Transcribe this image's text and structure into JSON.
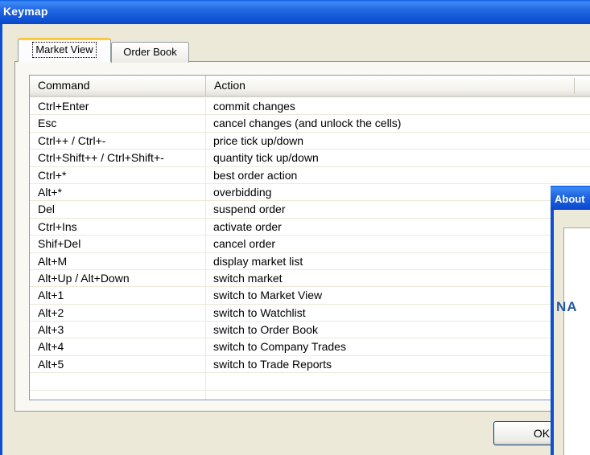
{
  "window": {
    "title": "Keymap",
    "close_glyph": "✕"
  },
  "tabs": [
    {
      "label": "Market View",
      "active": true
    },
    {
      "label": "Order Book",
      "active": false
    }
  ],
  "table": {
    "columns": [
      "Command",
      "Action"
    ],
    "rows": [
      {
        "command": "Ctrl+Enter",
        "action": "commit changes"
      },
      {
        "command": "Esc",
        "action": "cancel changes (and unlock the cells)"
      },
      {
        "command": "Ctrl++ / Ctrl+-",
        "action": "price tick up/down"
      },
      {
        "command": "Ctrl+Shift++ / Ctrl+Shift+-",
        "action": "quantity tick up/down"
      },
      {
        "command": "Ctrl+*",
        "action": "best order action"
      },
      {
        "command": "Alt+*",
        "action": "overbidding"
      },
      {
        "command": "Del",
        "action": "suspend order"
      },
      {
        "command": "Ctrl+Ins",
        "action": "activate order"
      },
      {
        "command": "Shif+Del",
        "action": "cancel order"
      },
      {
        "command": "Alt+M",
        "action": "display market list"
      },
      {
        "command": "Alt+Up / Alt+Down",
        "action": "switch market"
      },
      {
        "command": "Alt+1",
        "action": "switch to Market View"
      },
      {
        "command": "Alt+2",
        "action": "switch to Watchlist"
      },
      {
        "command": "Alt+3",
        "action": "switch to Order Book"
      },
      {
        "command": "Alt+4",
        "action": "switch to Company Trades"
      },
      {
        "command": "Alt+5",
        "action": "switch to Trade Reports"
      }
    ]
  },
  "buttons": {
    "ok_label": "OK"
  },
  "about_window": {
    "title": "About",
    "logo_text": "NA"
  }
}
